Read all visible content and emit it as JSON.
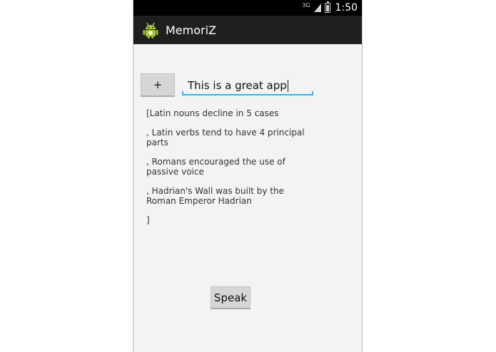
{
  "status_bar": {
    "network": "3G",
    "time": "1:50"
  },
  "action_bar": {
    "app_icon": "android-robot-icon",
    "title": "MemoriZ"
  },
  "add_button": {
    "label": "+"
  },
  "entry_field": {
    "value": "This is a great app"
  },
  "notes": [
    "[Latin nouns decline in 5 cases",
    ", Latin verbs tend to have 4 principal parts",
    ", Romans encouraged the use of passive voice",
    ", Hadrian's Wall was built by the Roman Emperor Hadrian",
    "]"
  ],
  "speak_button": {
    "label": "Speak"
  },
  "colors": {
    "accent": "#33b5e5",
    "action_bar": "#1f1f1f",
    "status_bar": "#000000",
    "button": "#d6d6d6"
  }
}
